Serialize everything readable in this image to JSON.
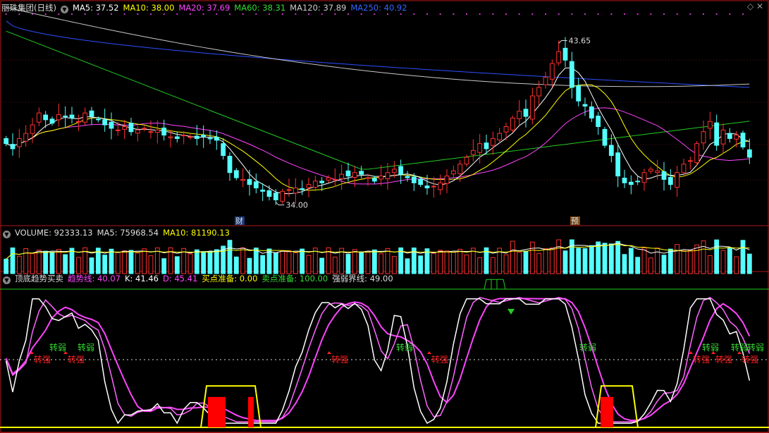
{
  "panel_main": {
    "title": "丽珠集团(日线)",
    "ma": [
      {
        "label": "MA5: 37.52",
        "color": "#ffffff"
      },
      {
        "label": "MA10: 38.00",
        "color": "#ffff00"
      },
      {
        "label": "MA20: 37.69",
        "color": "#ff44ff"
      },
      {
        "label": "MA60: 38.31",
        "color": "#33dd33"
      },
      {
        "label": "MA120: 37.89",
        "color": "#cccccc"
      },
      {
        "label": "MA250: 40.92",
        "color": "#3366ff"
      }
    ],
    "high_label": "43.65",
    "low_label": "34.00",
    "marker_cai": "财",
    "marker_yu": "预"
  },
  "panel_volume": {
    "items": [
      {
        "label": "VOLUME: 92333.13",
        "color": "#dddddd"
      },
      {
        "label": "MA5: 75968.54",
        "color": "#dddddd"
      },
      {
        "label": "MA10: 81190.13",
        "color": "#ffff00"
      }
    ]
  },
  "panel_ind": {
    "title": "顶底趋势买卖",
    "items": [
      {
        "label": "趋势线: 40.07",
        "color": "#ff44ff"
      },
      {
        "label": "K: 41.46",
        "color": "#ffffff"
      },
      {
        "label": "D: 45.41",
        "color": "#ff44ff"
      },
      {
        "label": "买点准备: 0.00",
        "color": "#ffff00"
      },
      {
        "label": "卖点准备: 100.00",
        "color": "#33dd33"
      },
      {
        "label": "强弱界线: 49.00",
        "color": "#dddddd"
      }
    ],
    "sig_weak": "转弱",
    "sig_strong": "转强"
  },
  "chart_data": {
    "type": "candlestick",
    "price_high": 43.65,
    "price_low": 34.0,
    "ma_latest": {
      "MA5": 37.52,
      "MA10": 38.0,
      "MA20": 37.69,
      "MA60": 38.31,
      "MA120": 37.89,
      "MA250": 40.92
    },
    "volume_latest": 92333.13,
    "indicator_latest": {
      "趋势线": 40.07,
      "K": 41.46,
      "D": 45.41,
      "买点准备": 0.0,
      "卖点准备": 100.0,
      "强弱界线": 49.0
    },
    "closes": [
      37.6,
      37.3,
      37.9,
      38.2,
      38.7,
      39.4,
      39.0,
      38.8,
      39.3,
      39.2,
      39.1,
      38.9,
      39.4,
      39.2,
      39.0,
      38.7,
      38.5,
      38.4,
      38.6,
      38.3,
      38.4,
      38.5,
      38.3,
      38.4,
      38.1,
      38.0,
      37.9,
      38.1,
      38.0,
      37.9,
      38.0,
      37.9,
      37.8,
      36.9,
      35.9,
      35.6,
      35.5,
      35.2,
      35.0,
      34.8,
      34.5,
      34.3,
      34.8,
      34.9,
      35.0,
      34.9,
      35.2,
      35.4,
      35.3,
      35.6,
      35.5,
      35.8,
      35.7,
      35.9,
      35.8,
      35.6,
      35.4,
      35.7,
      35.9,
      36.1,
      35.8,
      35.6,
      35.3,
      35.2,
      35.0,
      35.1,
      35.3,
      35.7,
      36.0,
      36.4,
      36.8,
      37.2,
      37.6,
      37.3,
      37.9,
      38.2,
      38.6,
      39.1,
      39.5,
      39.2,
      40.4,
      40.9,
      41.5,
      42.3,
      43.0,
      42.5,
      40.9,
      40.1,
      39.8,
      39.1,
      38.6,
      37.5,
      36.9,
      35.7,
      35.3,
      35.2,
      35.4,
      35.9,
      36.1,
      36.0,
      35.5,
      35.2,
      35.9,
      36.4,
      36.6,
      37.6,
      38.3,
      38.9,
      37.5,
      38.4,
      37.9,
      38.1,
      37.4,
      36.8
    ]
  }
}
